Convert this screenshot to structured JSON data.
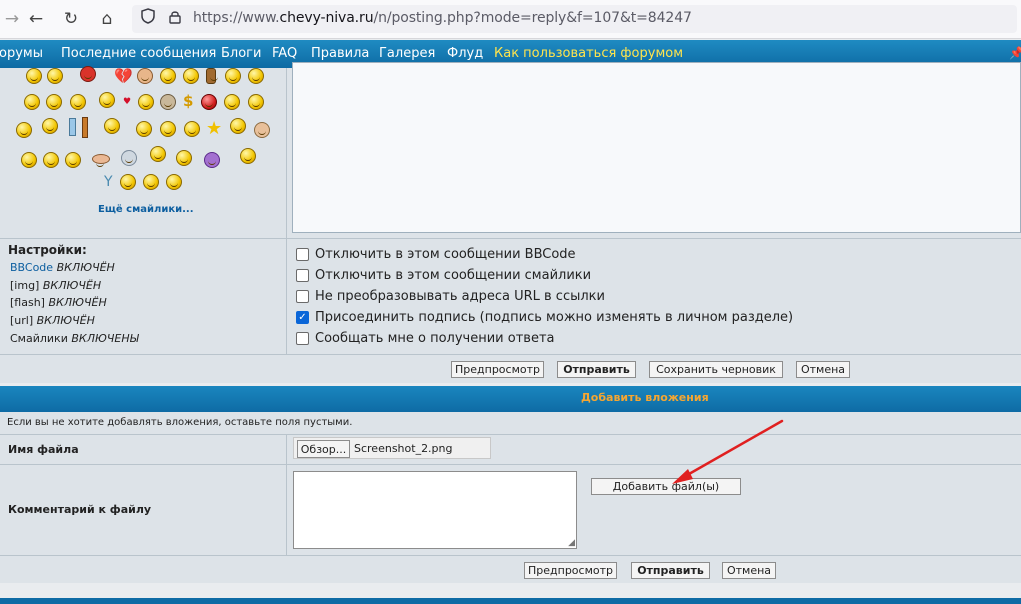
{
  "browser": {
    "url_prefix": "https://www.",
    "url_domain": "chevy-niva.ru",
    "url_rest": "/n/posting.php?mode=reply&f=107&t=84247"
  },
  "nav": {
    "items": [
      "орумы",
      "Последние сообщения",
      "Блоги",
      "FAQ",
      "Правила",
      "Галерея",
      "Флуд"
    ],
    "highlight": "Как пользоваться форумом",
    "highlight_color": "#ffe44d"
  },
  "smilies": {
    "more_link": "Ещё смайлики..."
  },
  "settings": {
    "title": "Настройки:",
    "rows": [
      {
        "name": "BBCode",
        "state": "ВКЛЮЧЁН"
      },
      {
        "name": "[img]",
        "state": "ВКЛЮЧЁН"
      },
      {
        "name": "[flash]",
        "state": "ВКЛЮЧЁН"
      },
      {
        "name": "[url]",
        "state": "ВКЛЮЧЁН"
      },
      {
        "name": "Смайлики",
        "state": "ВКЛЮЧЕНЫ"
      }
    ],
    "options": [
      {
        "label": "Отключить в этом сообщении BBCode",
        "checked": false
      },
      {
        "label": "Отключить в этом сообщении смайлики",
        "checked": false
      },
      {
        "label": "Не преобразовывать адреса URL в ссылки",
        "checked": false
      },
      {
        "label": "Присоединить подпись (подпись можно изменять в личном разделе)",
        "checked": true
      },
      {
        "label": "Сообщать мне о получении ответа",
        "checked": false
      }
    ]
  },
  "buttons": {
    "preview": "Предпросмотр",
    "submit": "Отправить",
    "save_draft": "Сохранить черновик",
    "cancel": "Отмена"
  },
  "attachments": {
    "header": "Добавить вложения",
    "hint": "Если вы не хотите добавлять вложения, оставьте поля пустыми.",
    "filename_label": "Имя файла",
    "browse_button": "Обзор...",
    "selected_file": "Screenshot_2.png",
    "comment_label": "Комментарий к файлу",
    "comment_value": "",
    "add_file_button": "Добавить файл(ы)"
  },
  "colors": {
    "nav_bg": "#1479b5",
    "header_text": "#f6a631",
    "arrow": "#e02020"
  }
}
